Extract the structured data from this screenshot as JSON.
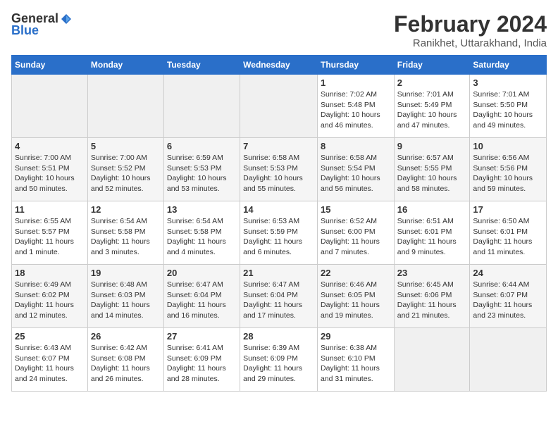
{
  "logo": {
    "general": "General",
    "blue": "Blue"
  },
  "title": "February 2024",
  "location": "Ranikhet, Uttarakhand, India",
  "days_of_week": [
    "Sunday",
    "Monday",
    "Tuesday",
    "Wednesday",
    "Thursday",
    "Friday",
    "Saturday"
  ],
  "weeks": [
    [
      {
        "day": "",
        "info": ""
      },
      {
        "day": "",
        "info": ""
      },
      {
        "day": "",
        "info": ""
      },
      {
        "day": "",
        "info": ""
      },
      {
        "day": "1",
        "info": "Sunrise: 7:02 AM\nSunset: 5:48 PM\nDaylight: 10 hours\nand 46 minutes."
      },
      {
        "day": "2",
        "info": "Sunrise: 7:01 AM\nSunset: 5:49 PM\nDaylight: 10 hours\nand 47 minutes."
      },
      {
        "day": "3",
        "info": "Sunrise: 7:01 AM\nSunset: 5:50 PM\nDaylight: 10 hours\nand 49 minutes."
      }
    ],
    [
      {
        "day": "4",
        "info": "Sunrise: 7:00 AM\nSunset: 5:51 PM\nDaylight: 10 hours\nand 50 minutes."
      },
      {
        "day": "5",
        "info": "Sunrise: 7:00 AM\nSunset: 5:52 PM\nDaylight: 10 hours\nand 52 minutes."
      },
      {
        "day": "6",
        "info": "Sunrise: 6:59 AM\nSunset: 5:53 PM\nDaylight: 10 hours\nand 53 minutes."
      },
      {
        "day": "7",
        "info": "Sunrise: 6:58 AM\nSunset: 5:53 PM\nDaylight: 10 hours\nand 55 minutes."
      },
      {
        "day": "8",
        "info": "Sunrise: 6:58 AM\nSunset: 5:54 PM\nDaylight: 10 hours\nand 56 minutes."
      },
      {
        "day": "9",
        "info": "Sunrise: 6:57 AM\nSunset: 5:55 PM\nDaylight: 10 hours\nand 58 minutes."
      },
      {
        "day": "10",
        "info": "Sunrise: 6:56 AM\nSunset: 5:56 PM\nDaylight: 10 hours\nand 59 minutes."
      }
    ],
    [
      {
        "day": "11",
        "info": "Sunrise: 6:55 AM\nSunset: 5:57 PM\nDaylight: 11 hours\nand 1 minute."
      },
      {
        "day": "12",
        "info": "Sunrise: 6:54 AM\nSunset: 5:58 PM\nDaylight: 11 hours\nand 3 minutes."
      },
      {
        "day": "13",
        "info": "Sunrise: 6:54 AM\nSunset: 5:58 PM\nDaylight: 11 hours\nand 4 minutes."
      },
      {
        "day": "14",
        "info": "Sunrise: 6:53 AM\nSunset: 5:59 PM\nDaylight: 11 hours\nand 6 minutes."
      },
      {
        "day": "15",
        "info": "Sunrise: 6:52 AM\nSunset: 6:00 PM\nDaylight: 11 hours\nand 7 minutes."
      },
      {
        "day": "16",
        "info": "Sunrise: 6:51 AM\nSunset: 6:01 PM\nDaylight: 11 hours\nand 9 minutes."
      },
      {
        "day": "17",
        "info": "Sunrise: 6:50 AM\nSunset: 6:01 PM\nDaylight: 11 hours\nand 11 minutes."
      }
    ],
    [
      {
        "day": "18",
        "info": "Sunrise: 6:49 AM\nSunset: 6:02 PM\nDaylight: 11 hours\nand 12 minutes."
      },
      {
        "day": "19",
        "info": "Sunrise: 6:48 AM\nSunset: 6:03 PM\nDaylight: 11 hours\nand 14 minutes."
      },
      {
        "day": "20",
        "info": "Sunrise: 6:47 AM\nSunset: 6:04 PM\nDaylight: 11 hours\nand 16 minutes."
      },
      {
        "day": "21",
        "info": "Sunrise: 6:47 AM\nSunset: 6:04 PM\nDaylight: 11 hours\nand 17 minutes."
      },
      {
        "day": "22",
        "info": "Sunrise: 6:46 AM\nSunset: 6:05 PM\nDaylight: 11 hours\nand 19 minutes."
      },
      {
        "day": "23",
        "info": "Sunrise: 6:45 AM\nSunset: 6:06 PM\nDaylight: 11 hours\nand 21 minutes."
      },
      {
        "day": "24",
        "info": "Sunrise: 6:44 AM\nSunset: 6:07 PM\nDaylight: 11 hours\nand 23 minutes."
      }
    ],
    [
      {
        "day": "25",
        "info": "Sunrise: 6:43 AM\nSunset: 6:07 PM\nDaylight: 11 hours\nand 24 minutes."
      },
      {
        "day": "26",
        "info": "Sunrise: 6:42 AM\nSunset: 6:08 PM\nDaylight: 11 hours\nand 26 minutes."
      },
      {
        "day": "27",
        "info": "Sunrise: 6:41 AM\nSunset: 6:09 PM\nDaylight: 11 hours\nand 28 minutes."
      },
      {
        "day": "28",
        "info": "Sunrise: 6:39 AM\nSunset: 6:09 PM\nDaylight: 11 hours\nand 29 minutes."
      },
      {
        "day": "29",
        "info": "Sunrise: 6:38 AM\nSunset: 6:10 PM\nDaylight: 11 hours\nand 31 minutes."
      },
      {
        "day": "",
        "info": ""
      },
      {
        "day": "",
        "info": ""
      }
    ]
  ]
}
